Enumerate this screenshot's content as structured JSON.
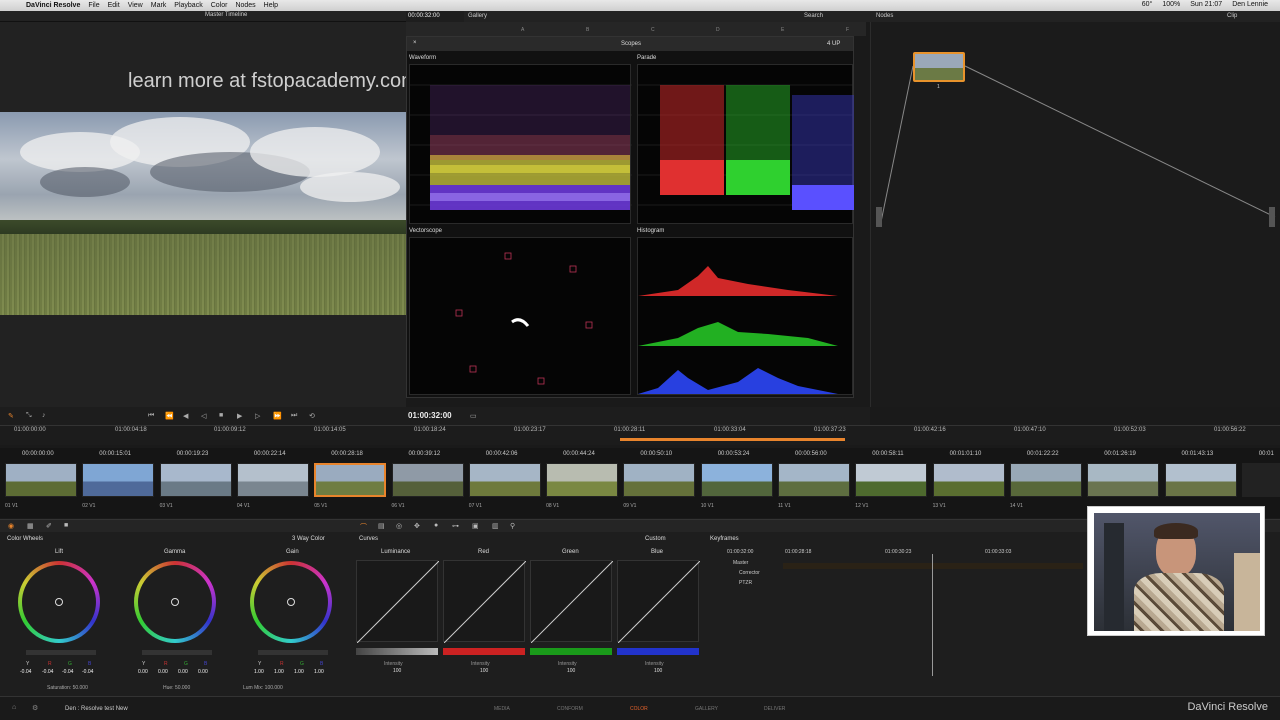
{
  "menubar": {
    "app": "DaVinci Resolve",
    "items": [
      "File",
      "Edit",
      "View",
      "Mark",
      "Playback",
      "Color",
      "Nodes",
      "Help"
    ],
    "status": [
      "60°",
      "100%",
      "Sun 21:07",
      "Den Lennie"
    ]
  },
  "viewer": {
    "timeline_name": "Master Timeline",
    "timecode": "00:00:32:00",
    "watermark": "learn more at fstopacademy.com"
  },
  "gallery": {
    "title": "Gallery",
    "search": "Search",
    "tabs": [
      "A",
      "B",
      "C",
      "D",
      "E",
      "F"
    ]
  },
  "scopes": {
    "title": "Scopes",
    "layout": "4 UP",
    "panels": [
      "Waveform",
      "Parade",
      "Vectorscope",
      "Histogram"
    ]
  },
  "nodes": {
    "title": "Nodes",
    "mode": "Clip",
    "node_label": "1"
  },
  "transport": {
    "timecode": "01:00:32:00"
  },
  "ruler": [
    "01:00:00:00",
    "01:00:04:18",
    "01:00:09:12",
    "01:00:14:05",
    "01:00:18:24",
    "01:00:23:17",
    "01:00:28:11",
    "01:00:33:04",
    "01:00:37:23",
    "01:00:42:16",
    "01:00:47:10",
    "01:00:52:03",
    "01:00:56:22"
  ],
  "clips": [
    {
      "tc": "00:00:00:00",
      "label": "01 V1"
    },
    {
      "tc": "00:00:15:01",
      "label": "02 V1"
    },
    {
      "tc": "00:00:19:23",
      "label": "03 V1"
    },
    {
      "tc": "00:00:22:14",
      "label": "04 V1"
    },
    {
      "tc": "00:00:28:18",
      "label": "05 V1"
    },
    {
      "tc": "00:00:39:12",
      "label": "06 V1"
    },
    {
      "tc": "00:00:42:06",
      "label": "07 V1"
    },
    {
      "tc": "00:00:44:24",
      "label": "08 V1"
    },
    {
      "tc": "00:00:50:10",
      "label": "09 V1"
    },
    {
      "tc": "00:00:53:24",
      "label": "10 V1"
    },
    {
      "tc": "00:00:56:00",
      "label": "11 V1"
    },
    {
      "tc": "00:00:58:11",
      "label": "12 V1"
    },
    {
      "tc": "00:01:01:10",
      "label": "13 V1"
    },
    {
      "tc": "00:01:22:22",
      "label": "14 V1"
    },
    {
      "tc": "00:01:26:19",
      "label": ""
    },
    {
      "tc": "00:01:43:13",
      "label": ""
    },
    {
      "tc": "00:01",
      "label": ""
    }
  ],
  "color_wheels": {
    "title": "Color Wheels",
    "mode": "3 Way Color",
    "wheels": [
      {
        "name": "Lift",
        "vals": [
          "-0.04",
          "-0.04",
          "-0.04",
          "-0.04"
        ]
      },
      {
        "name": "Gamma",
        "vals": [
          "0.00",
          "0.00",
          "0.00",
          "0.00"
        ]
      },
      {
        "name": "Gain",
        "vals": [
          "1.00",
          "1.00",
          "1.00",
          "1.00"
        ]
      }
    ],
    "channel_labels": [
      "Y",
      "R",
      "G",
      "B"
    ],
    "saturation": "Saturation: 50.000",
    "hue": "Hue: 50.000",
    "lum_mix": "Lum Mix: 100.000"
  },
  "curves": {
    "title": "Curves",
    "mode": "Custom",
    "channels": [
      {
        "name": "Luminance",
        "intensity": "100",
        "color": "#888888"
      },
      {
        "name": "Red",
        "intensity": "100",
        "color": "#cc2222"
      },
      {
        "name": "Green",
        "intensity": "100",
        "color": "#22aa22"
      },
      {
        "name": "Blue",
        "intensity": "100",
        "color": "#2233cc"
      }
    ],
    "intensity_label": "Intensity"
  },
  "keyframes": {
    "title": "Keyframes",
    "times": [
      "01:00:32:00",
      "01:00:28:18",
      "01:00:30:23",
      "01:00:33:03"
    ],
    "tracks": [
      "Master",
      "Corrector",
      "PTZR"
    ]
  },
  "footer": {
    "project": "Den : Resolve test New",
    "pages": [
      "MEDIA",
      "CONFORM",
      "COLOR",
      "GALLERY",
      "DELIVER"
    ],
    "active_page": "COLOR",
    "brand": "DaVinci Resolve"
  },
  "colors": {
    "accent": "#e8932c",
    "active": "#e8642c"
  }
}
